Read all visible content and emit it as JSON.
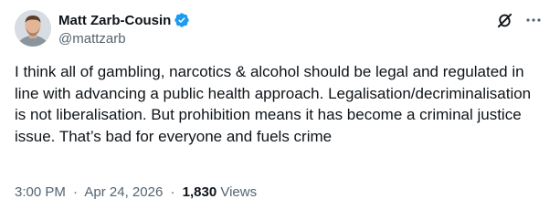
{
  "author": {
    "display_name": "Matt Zarb-Cousin",
    "handle": "@mattzarb",
    "verified": true,
    "verified_color": "#1d9bf0"
  },
  "icons": {
    "verified": "verified-badge-icon",
    "grok": "grok-icon",
    "more": "more-options-icon"
  },
  "tweet": {
    "text": "I think all of gambling, narcotics & alcohol should be legal and regulated in line with advancing a public health approach. Legalisation/decriminalisation is not liberalisation. But prohibition means it has become a criminal justice issue. That’s bad for everyone and fuels crime"
  },
  "meta": {
    "time": "3:00 PM",
    "date_separator": "·",
    "date": "Apr 24, 2026",
    "views_separator": "·",
    "views_count": "1,830",
    "views_label": "Views"
  },
  "colors": {
    "text_primary": "#0f1419",
    "text_secondary": "#536471",
    "background": "#ffffff"
  }
}
